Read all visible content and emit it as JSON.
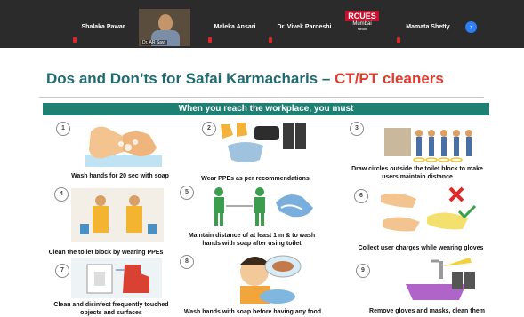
{
  "meeting": {
    "participants": [
      {
        "name": "Shalaka Pawar"
      },
      {
        "name": "Dr. AR Savi"
      },
      {
        "name": "Maleka Ansari"
      },
      {
        "name": "Dr. Vivek Pardeshi"
      },
      {
        "name": "Mamata Shetty"
      }
    ],
    "logo": {
      "brand": "RCUES",
      "city": "Mumbai",
      "sub": "Nirlon"
    },
    "next_icon": "chevron-right-icon"
  },
  "slide": {
    "title_main": "Dos and Don’ts for Safai Karmacharis – ",
    "title_highlight": "CT/PT cleaners",
    "banner": "When you reach the workplace, you must",
    "steps": [
      {
        "num": "1",
        "caption": "Wash hands for 20 sec with soap"
      },
      {
        "num": "2",
        "caption": "Wear PPEs as per recommendations"
      },
      {
        "num": "3",
        "caption": "Draw circles outside the toilet block to make users maintain distance"
      },
      {
        "num": "4",
        "caption": "Clean the toilet block by wearing PPEs"
      },
      {
        "num": "5",
        "caption": "Maintain distance of at least 1 m & to wash hands with soap after using toilet"
      },
      {
        "num": "6",
        "caption": "Collect user charges while wearing gloves"
      },
      {
        "num": "7",
        "caption": "Clean and disinfect frequently touched objects and surfaces"
      },
      {
        "num": "8",
        "caption": "Wash hands with soap before having any food"
      },
      {
        "num": "9",
        "caption": "Remove gloves and masks, clean them"
      }
    ]
  }
}
